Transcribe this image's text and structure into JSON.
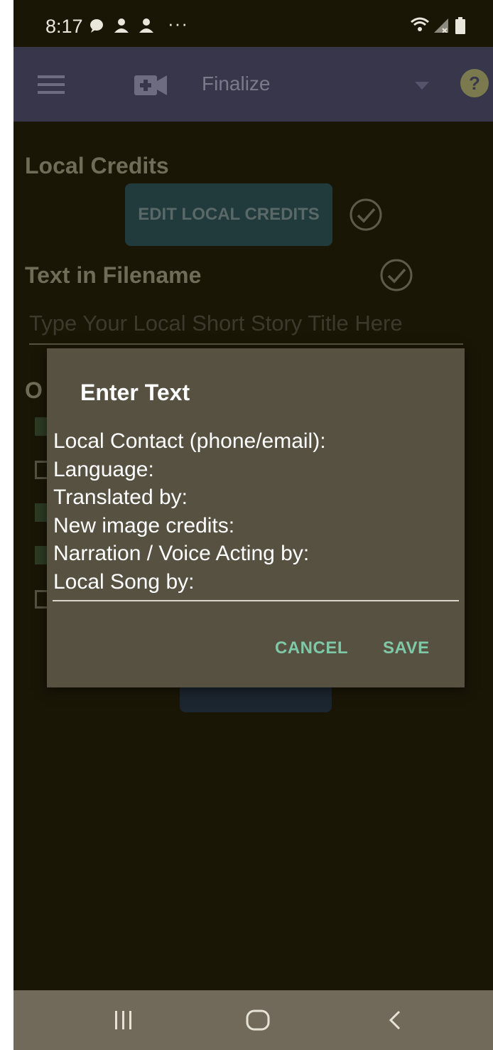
{
  "status_bar": {
    "time": "8:17",
    "notification_icons": [
      "chat-bubble-icon",
      "user-icon",
      "user-icon"
    ],
    "more": "···",
    "right_icons": [
      "wifi-icon",
      "signal-icon",
      "battery-icon"
    ]
  },
  "app_bar": {
    "menu_icon": "hamburger-menu-icon",
    "app_icon": "video-add-icon",
    "title": "Finalize",
    "dropdown_icon": "dropdown-arrow-icon",
    "help_icon": "help-icon"
  },
  "page": {
    "local_credits_heading": "Local Credits",
    "edit_local_credits_button": "EDIT LOCAL CREDITS",
    "text_in_filename_heading": "Text in Filename",
    "story_title_placeholder": "Type Your Local Short Story Title Here",
    "options_heading_partial": "O",
    "checkboxes": [
      {
        "checked": true
      },
      {
        "checked": false
      },
      {
        "checked": true
      },
      {
        "checked": true
      },
      {
        "checked": false
      }
    ]
  },
  "dialog": {
    "title": "Enter Text",
    "lines": [
      "Local Contact (phone/email):",
      "Language:",
      "Translated by:",
      "New image credits:",
      "Narration / Voice Acting by:",
      "Local Song by:"
    ],
    "cancel_label": "CANCEL",
    "save_label": "SAVE"
  },
  "nav_bar": {
    "recents": "recent-apps-icon",
    "home": "home-icon",
    "back": "back-icon"
  },
  "colors": {
    "background": "#1a1606",
    "app_bar": "#37364a",
    "dialog": "#575142",
    "accent": "#7fc9a8",
    "nav_bar": "#716a5a"
  }
}
